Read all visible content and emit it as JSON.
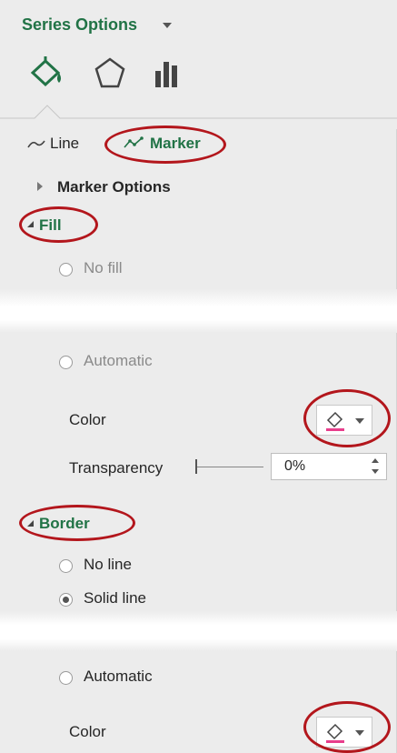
{
  "header": {
    "title": "Series Options"
  },
  "tabs": [
    {
      "icon": "paint-bucket-icon"
    },
    {
      "icon": "pentagon-icon"
    },
    {
      "icon": "bar-chart-icon"
    }
  ],
  "subtabs": {
    "line_label": "Line",
    "marker_label": "Marker"
  },
  "marker_options": {
    "label": "Marker Options"
  },
  "fill": {
    "label": "Fill",
    "options": [
      {
        "label": "No fill",
        "checked": false
      },
      {
        "label": "Automatic",
        "checked": false
      }
    ],
    "color_label": "Color",
    "transparency_label": "Transparency",
    "transparency_value": "0%"
  },
  "border": {
    "label": "Border",
    "options": [
      {
        "label": "No line",
        "checked": false
      },
      {
        "label": "Solid line",
        "checked": true
      },
      {
        "label": "Automatic",
        "checked": false
      }
    ],
    "color_label": "Color"
  },
  "colors": {
    "accent_green": "#217346",
    "highlight_red": "#b3161c",
    "fill_swatch": "#e83e8c"
  }
}
